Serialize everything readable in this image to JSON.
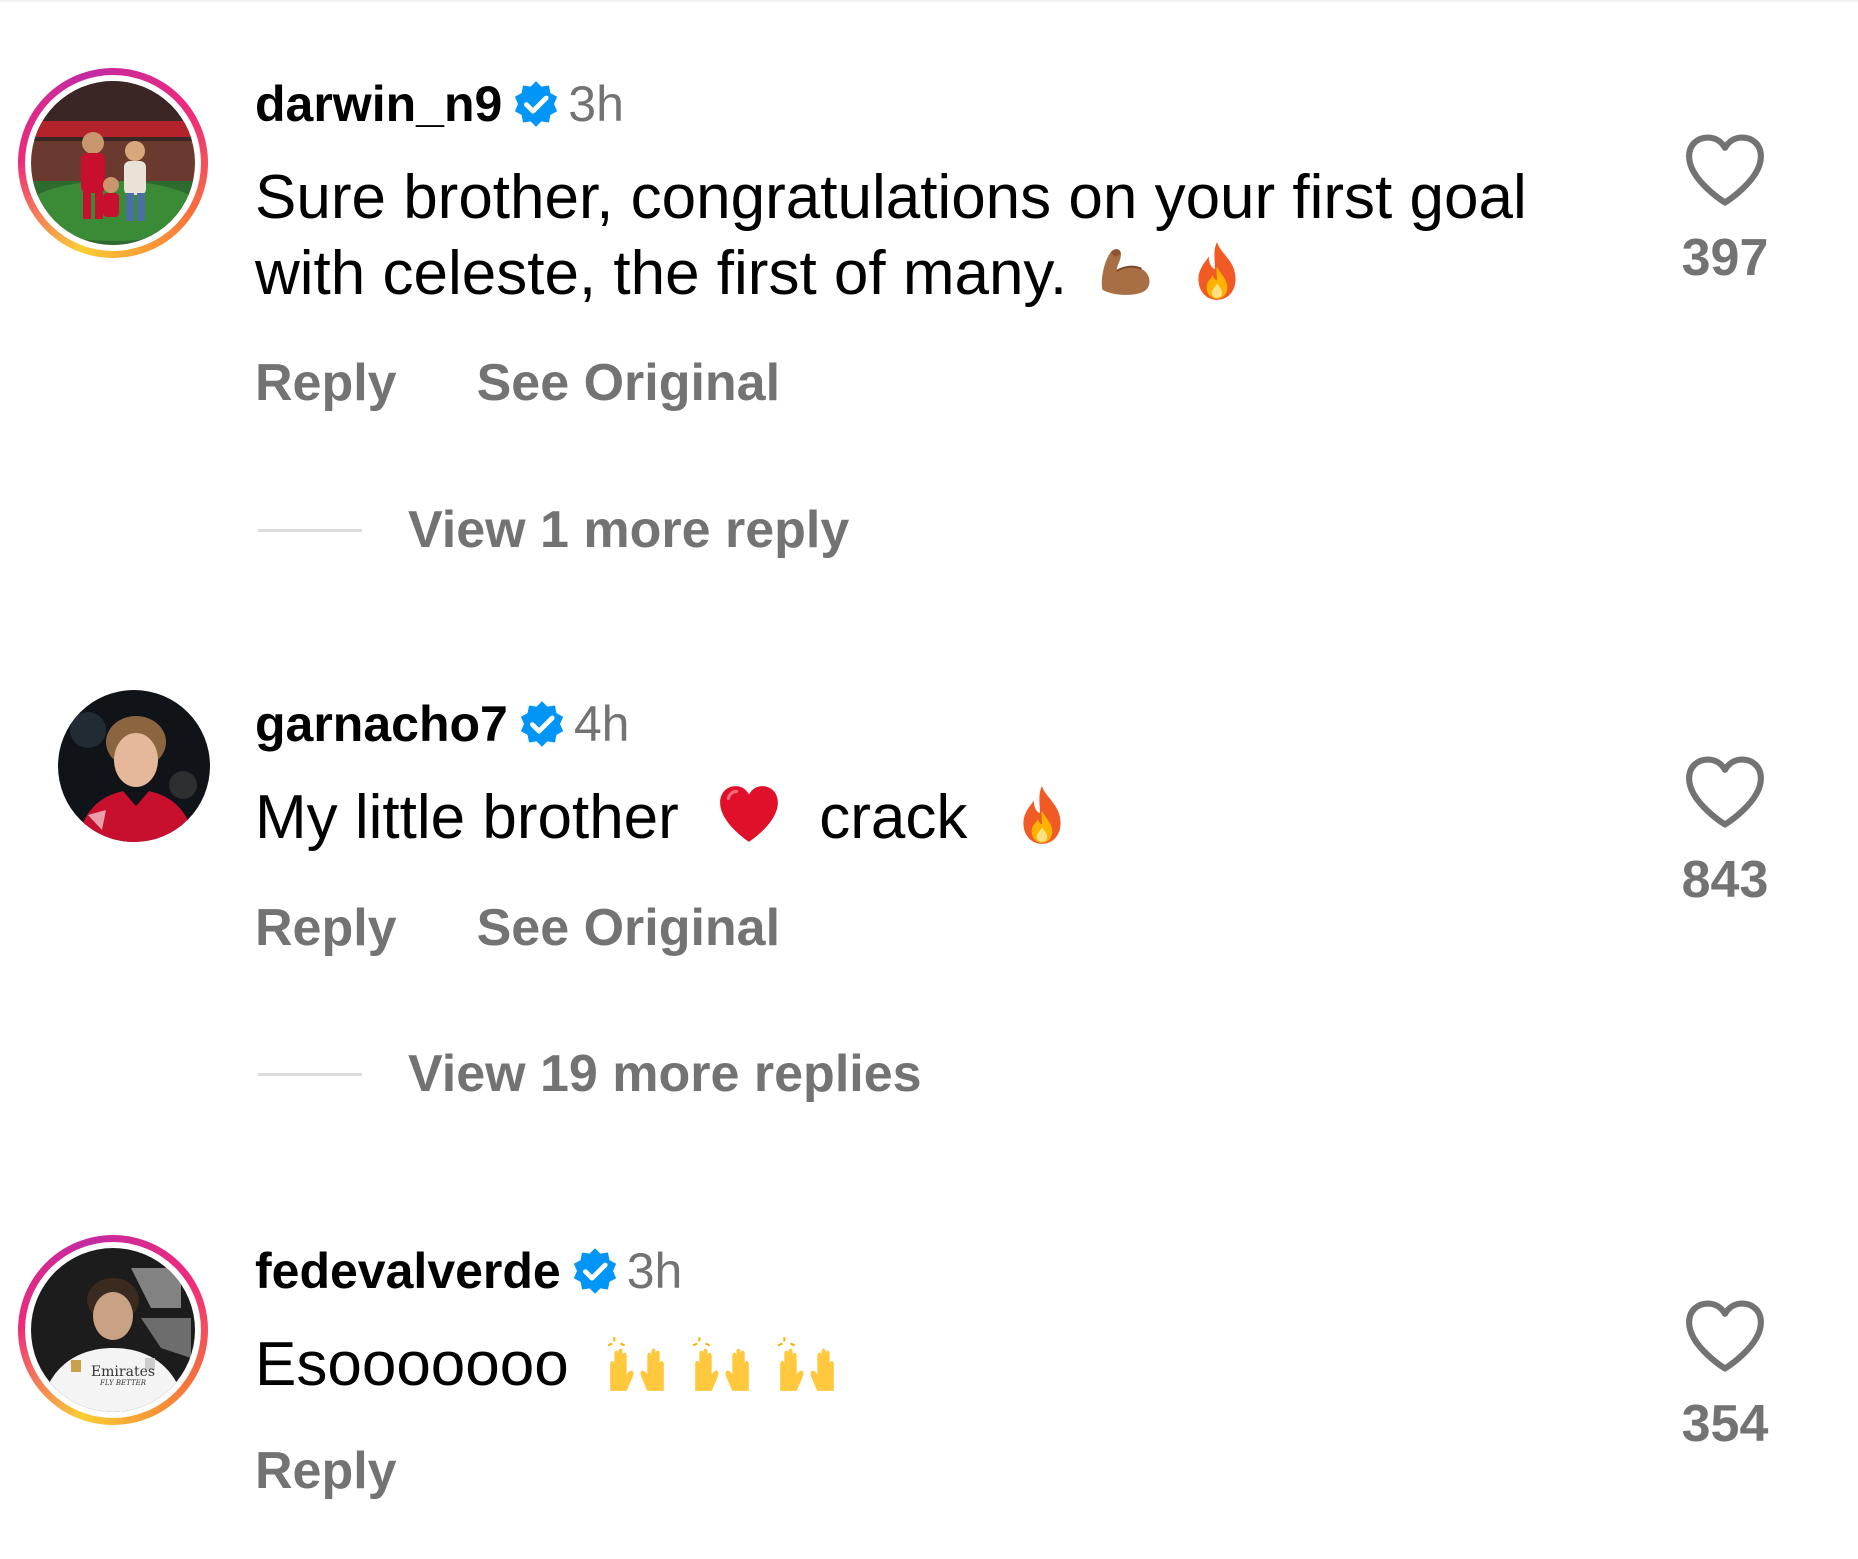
{
  "colors": {
    "text": "#000000",
    "secondary": "#737373",
    "verified_badge": "#0095f6",
    "divider": "#dbdbdb"
  },
  "comments": [
    {
      "username": "darwin_n9",
      "verified": true,
      "time": "3h",
      "text": "Sure brother, congratulations on your first goal with celeste, the first of many.",
      "emojis": [
        "flexed-biceps-emoji",
        "fire-emoji"
      ],
      "reply_label": "Reply",
      "see_original_label": "See Original",
      "view_replies_label": "View 1 more reply",
      "likes": "397",
      "story_ring": true
    },
    {
      "username": "garnacho7",
      "verified": true,
      "time": "4h",
      "text_part1": "My little brother",
      "text_part2": "crack",
      "emojis": [
        "red-heart-emoji",
        "fire-emoji"
      ],
      "reply_label": "Reply",
      "see_original_label": "See Original",
      "view_replies_label": "View 19 more replies",
      "likes": "843",
      "story_ring": false
    },
    {
      "username": "fedevalverde",
      "verified": true,
      "time": "3h",
      "text": "Esooooooo",
      "emojis": [
        "raising-hands-emoji",
        "raising-hands-emoji",
        "raising-hands-emoji"
      ],
      "reply_label": "Reply",
      "likes": "354",
      "story_ring": true,
      "avatar_shirt_text": "Emirates",
      "avatar_shirt_subtext": "FLY BETTER"
    }
  ]
}
